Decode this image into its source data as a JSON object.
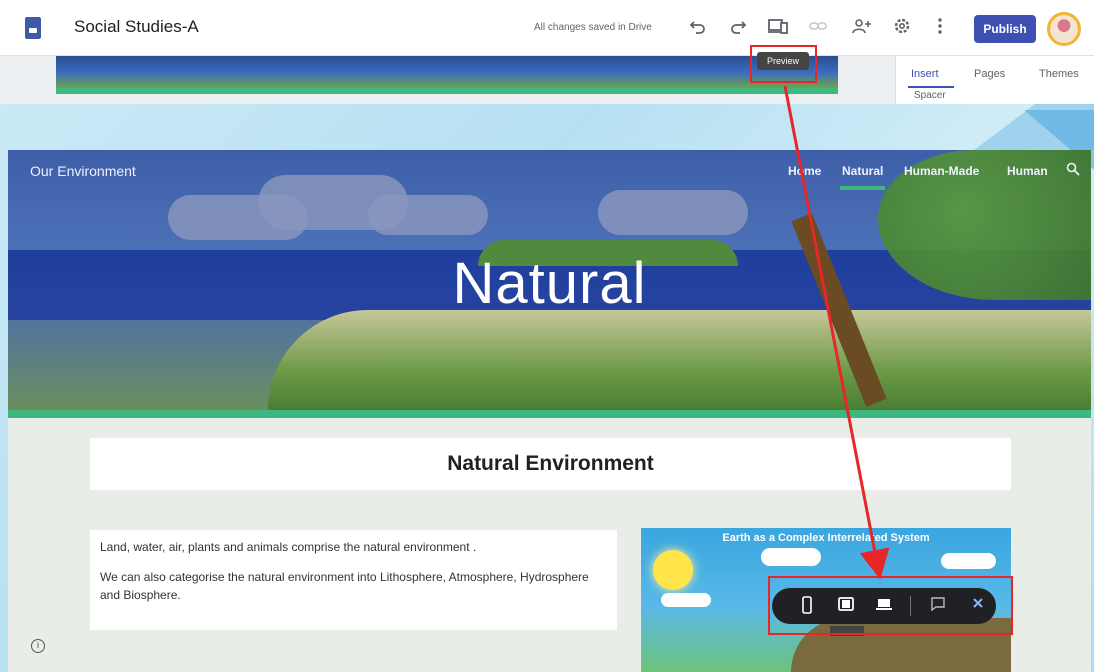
{
  "editor": {
    "doc_title": "Social Studies-A",
    "save_status": "All changes saved in Drive",
    "tooltip": "Preview",
    "publish_label": "Publish",
    "side_tabs": [
      "Insert",
      "Pages",
      "Themes"
    ],
    "side_item": "Spacer",
    "icons": [
      "undo-icon",
      "redo-icon",
      "preview-icon",
      "link-icon",
      "share-icon",
      "settings-icon",
      "more-icon"
    ]
  },
  "site": {
    "name": "Our Environment",
    "nav": [
      "Home",
      "Natural",
      "Human-Made",
      "Human"
    ],
    "active_nav": "Natural",
    "hero_title": "Natural",
    "section_title": "Natural Environment",
    "paragraphs": [
      "Land, water, air, plants and animals comprise the natural environment .",
      "We can also categorise the natural environment into Lithosphere, Atmosphere, Hydrosphere and Biosphere."
    ],
    "infographic_title": "Earth as a Complex Interrelated System"
  },
  "preview_toolbar": {
    "icons": [
      "phone-icon",
      "tablet-icon",
      "laptop-icon",
      "feedback-icon",
      "close-icon"
    ]
  },
  "colors": {
    "accent": "#3e50b4",
    "highlight": "#e8262a",
    "site_stripe": "#3fb880"
  }
}
